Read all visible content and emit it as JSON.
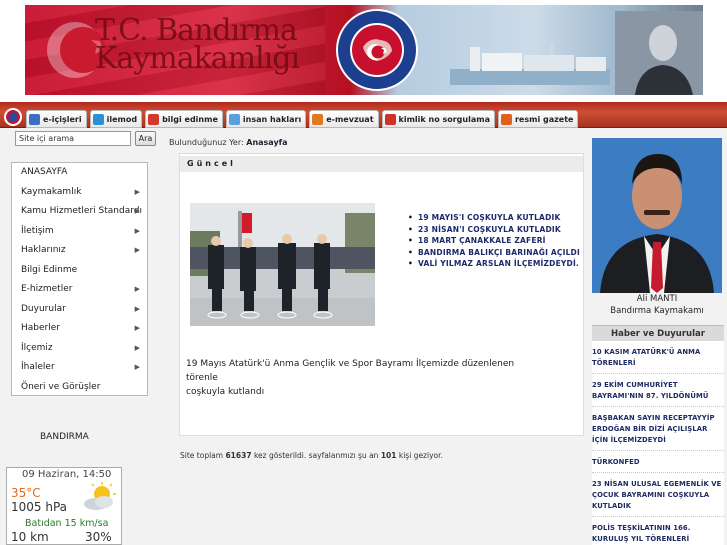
{
  "banner": {
    "title_line1": "T.C. Bandırma",
    "title_line2": "Kaymakamlığı",
    "seal_text_top": "TÜRKİYE CUMHURİYETİ",
    "seal_text_bottom": "İÇİŞLERİ BAKANLIĞI"
  },
  "nav": {
    "tabs": [
      {
        "label": "e-içişleri",
        "icon": "e-icisleri-icon",
        "color": "#3a6fc4"
      },
      {
        "label": "ilemod",
        "icon": "ilemod-icon",
        "color": "#2d8fd8"
      },
      {
        "label": "bilgi edinme",
        "icon": "info-icon",
        "color": "#d33a2c"
      },
      {
        "label": "insan hakları",
        "icon": "human-rights-icon",
        "color": "#5aa0e0"
      },
      {
        "label": "e-mevzuat",
        "icon": "legislation-icon",
        "color": "#e07a20"
      },
      {
        "label": "kimlik no sorgulama",
        "icon": "id-query-icon",
        "color": "#d0302a"
      },
      {
        "label": "resmi gazete",
        "icon": "gazette-icon",
        "color": "#e06020"
      }
    ]
  },
  "search": {
    "value": "Site içi arama",
    "button_label": "Ara"
  },
  "breadcrumb": {
    "prefix": "Bulunduğunuz Yer:",
    "current": "Anasayfa"
  },
  "sidebar": {
    "items": [
      {
        "label": "ANASAYFA",
        "has_arrow": false
      },
      {
        "label": "Kaymakamlık",
        "has_arrow": true
      },
      {
        "label": "Kamu Hizmetleri Standardı",
        "has_arrow": true
      },
      {
        "label": "İletişim",
        "has_arrow": true
      },
      {
        "label": "Haklarınız",
        "has_arrow": true
      },
      {
        "label": "Bilgi Edinme",
        "has_arrow": false
      },
      {
        "label": "E-hizmetler",
        "has_arrow": true
      },
      {
        "label": "Duyurular",
        "has_arrow": true
      },
      {
        "label": "Haberler",
        "has_arrow": true
      },
      {
        "label": "İlçemiz",
        "has_arrow": true
      },
      {
        "label": "İhaleler",
        "has_arrow": true
      },
      {
        "label": "Öneri ve Görüşler",
        "has_arrow": false
      }
    ],
    "location": "BANDIRMA"
  },
  "weather": {
    "date": "09 Haziran, 14:50",
    "temperature": "35°C",
    "pressure": "1005 hPa",
    "wind": "Batıdan 15 km/sa",
    "visibility": "10 km",
    "humidity": "30%",
    "icon": "sun-cloud-icon"
  },
  "main": {
    "section_title": "Güncel",
    "news_links": [
      "19 MAYIS'I COŞKUYLA KUTLADIK",
      "23 NİSAN'I COŞKUYLA KUTLADIK",
      "18 MART ÇANAKKALE ZAFERİ",
      "BANDIRMA BALIKÇI BARINAĞI AÇILDI",
      "VALİ YILMAZ ARSLAN İLÇEMİZDEYDİ."
    ],
    "caption_line1": "19 Mayıs Atatürk'ü Anma Gençlik ve Spor Bayramı İlçemizde düzenlenen törenle",
    "caption_line2": "coşkuyla kutlandı"
  },
  "counter": {
    "prefix": "Site toplam",
    "total": "61637",
    "middle": "kez gösterildi. sayfalanmızı şu an",
    "online": "101",
    "suffix": "kişi geziyor."
  },
  "official": {
    "name": "Ali MANTI",
    "title": "Bandırma Kaymakamı"
  },
  "news_box": {
    "header": "Haber ve Duyurular",
    "items": [
      "10 KASIM ATATÜRK'Ü ANMA TÖRENLERİ",
      "29 EKİM CUMHURİYET BAYRAMI'NIN 87. YILDÖNÜMÜ",
      "BAŞBAKAN SAYIN RECEPTAYYİP ERDOĞAN BİR DİZİ AÇILIŞLAR İÇİN İLÇEMİZDEYDİ",
      "TÜRKONFED",
      "23 NİSAN ULUSAL EGEMENLİK VE ÇOCUK BAYRAMINI COŞKUYLA KUTLADIK",
      "POLİS TEŞKİLATININ 166. KURULUŞ YIL TÖRENLERİ KUTLANDI"
    ]
  }
}
